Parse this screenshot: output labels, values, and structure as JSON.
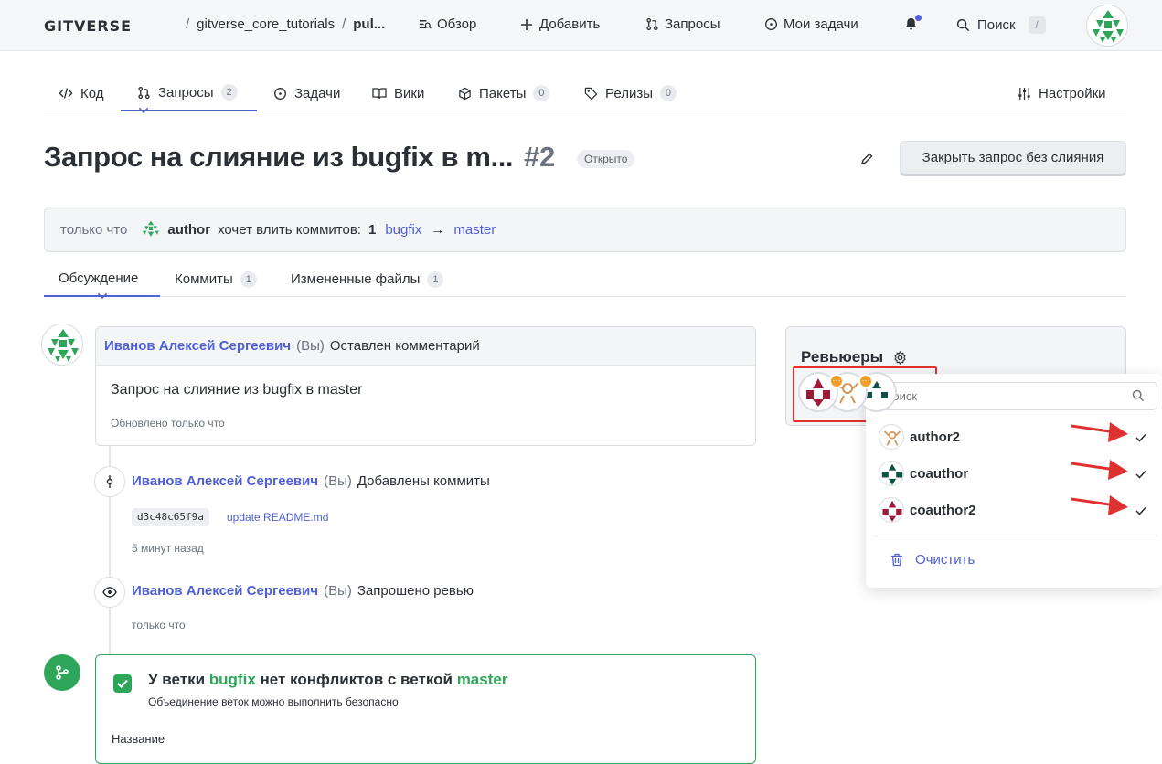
{
  "header": {
    "logo": "GITVERSE",
    "breadcrumb": {
      "sep1": "/",
      "repo": "gitverse_core_tutorials",
      "sep2": "/",
      "current": "pul..."
    },
    "nav": {
      "overview": "Обзор",
      "add": "Добавить",
      "requests": "Запросы",
      "tasks": "Мои задачи"
    },
    "search": {
      "label": "Поиск",
      "shortcut": "/"
    }
  },
  "tabs": {
    "code": "Код",
    "requests": "Запросы",
    "requests_count": "2",
    "tasks": "Задачи",
    "wiki": "Вики",
    "packages": "Пакеты",
    "packages_count": "0",
    "releases": "Релизы",
    "releases_count": "0",
    "settings": "Настройки"
  },
  "pr": {
    "title": "Запрос на слияние из bugfix в m...",
    "number": "#2",
    "status": "Открыто",
    "close_button": "Закрыть запрос без слияния",
    "info": {
      "time": "только что",
      "author": "author",
      "action": "хочет влить коммитов:",
      "commits": "1",
      "from": "bugfix",
      "arrow": "→",
      "to": "master"
    }
  },
  "subtabs": {
    "discussion": "Обсуждение",
    "commits": "Коммиты",
    "commits_count": "1",
    "files": "Измененные файлы",
    "files_count": "1"
  },
  "comment": {
    "author": "Иванов Алексей Сергеевич",
    "you": "(Вы)",
    "action": "Оставлен комментарий",
    "body": "Запрос на слияние из bugfix в master",
    "updated": "Обновлено только что"
  },
  "events": [
    {
      "author": "Иванов Алексей Сергеевич",
      "you": "(Вы)",
      "action": "Добавлены коммиты",
      "sha": "d3c48c65f9a",
      "message": "update README.md",
      "time": "5 минут назад"
    },
    {
      "author": "Иванов Алексей Сергеевич",
      "you": "(Вы)",
      "action": "Запрошено ревью",
      "time": "только что"
    }
  ],
  "merge": {
    "prefix": "У ветки",
    "branch_from": "bugfix",
    "middle": "нет конфликтов с веткой",
    "branch_to": "master",
    "subtitle": "Объединение веток можно выполнить безопасно",
    "name_label": "Название"
  },
  "reviewers": {
    "title": "Ревьюеры",
    "dropdown": {
      "search_placeholder": "Поиск",
      "items": [
        {
          "name": "author2",
          "selected": true
        },
        {
          "name": "coauthor",
          "selected": true
        },
        {
          "name": "coauthor2",
          "selected": true
        }
      ],
      "clear": "Очистить"
    }
  },
  "colors": {
    "accent": "#4f5fd6",
    "success": "#2ea65a",
    "annotation": "#e03131",
    "pending": "#f29d2a"
  }
}
